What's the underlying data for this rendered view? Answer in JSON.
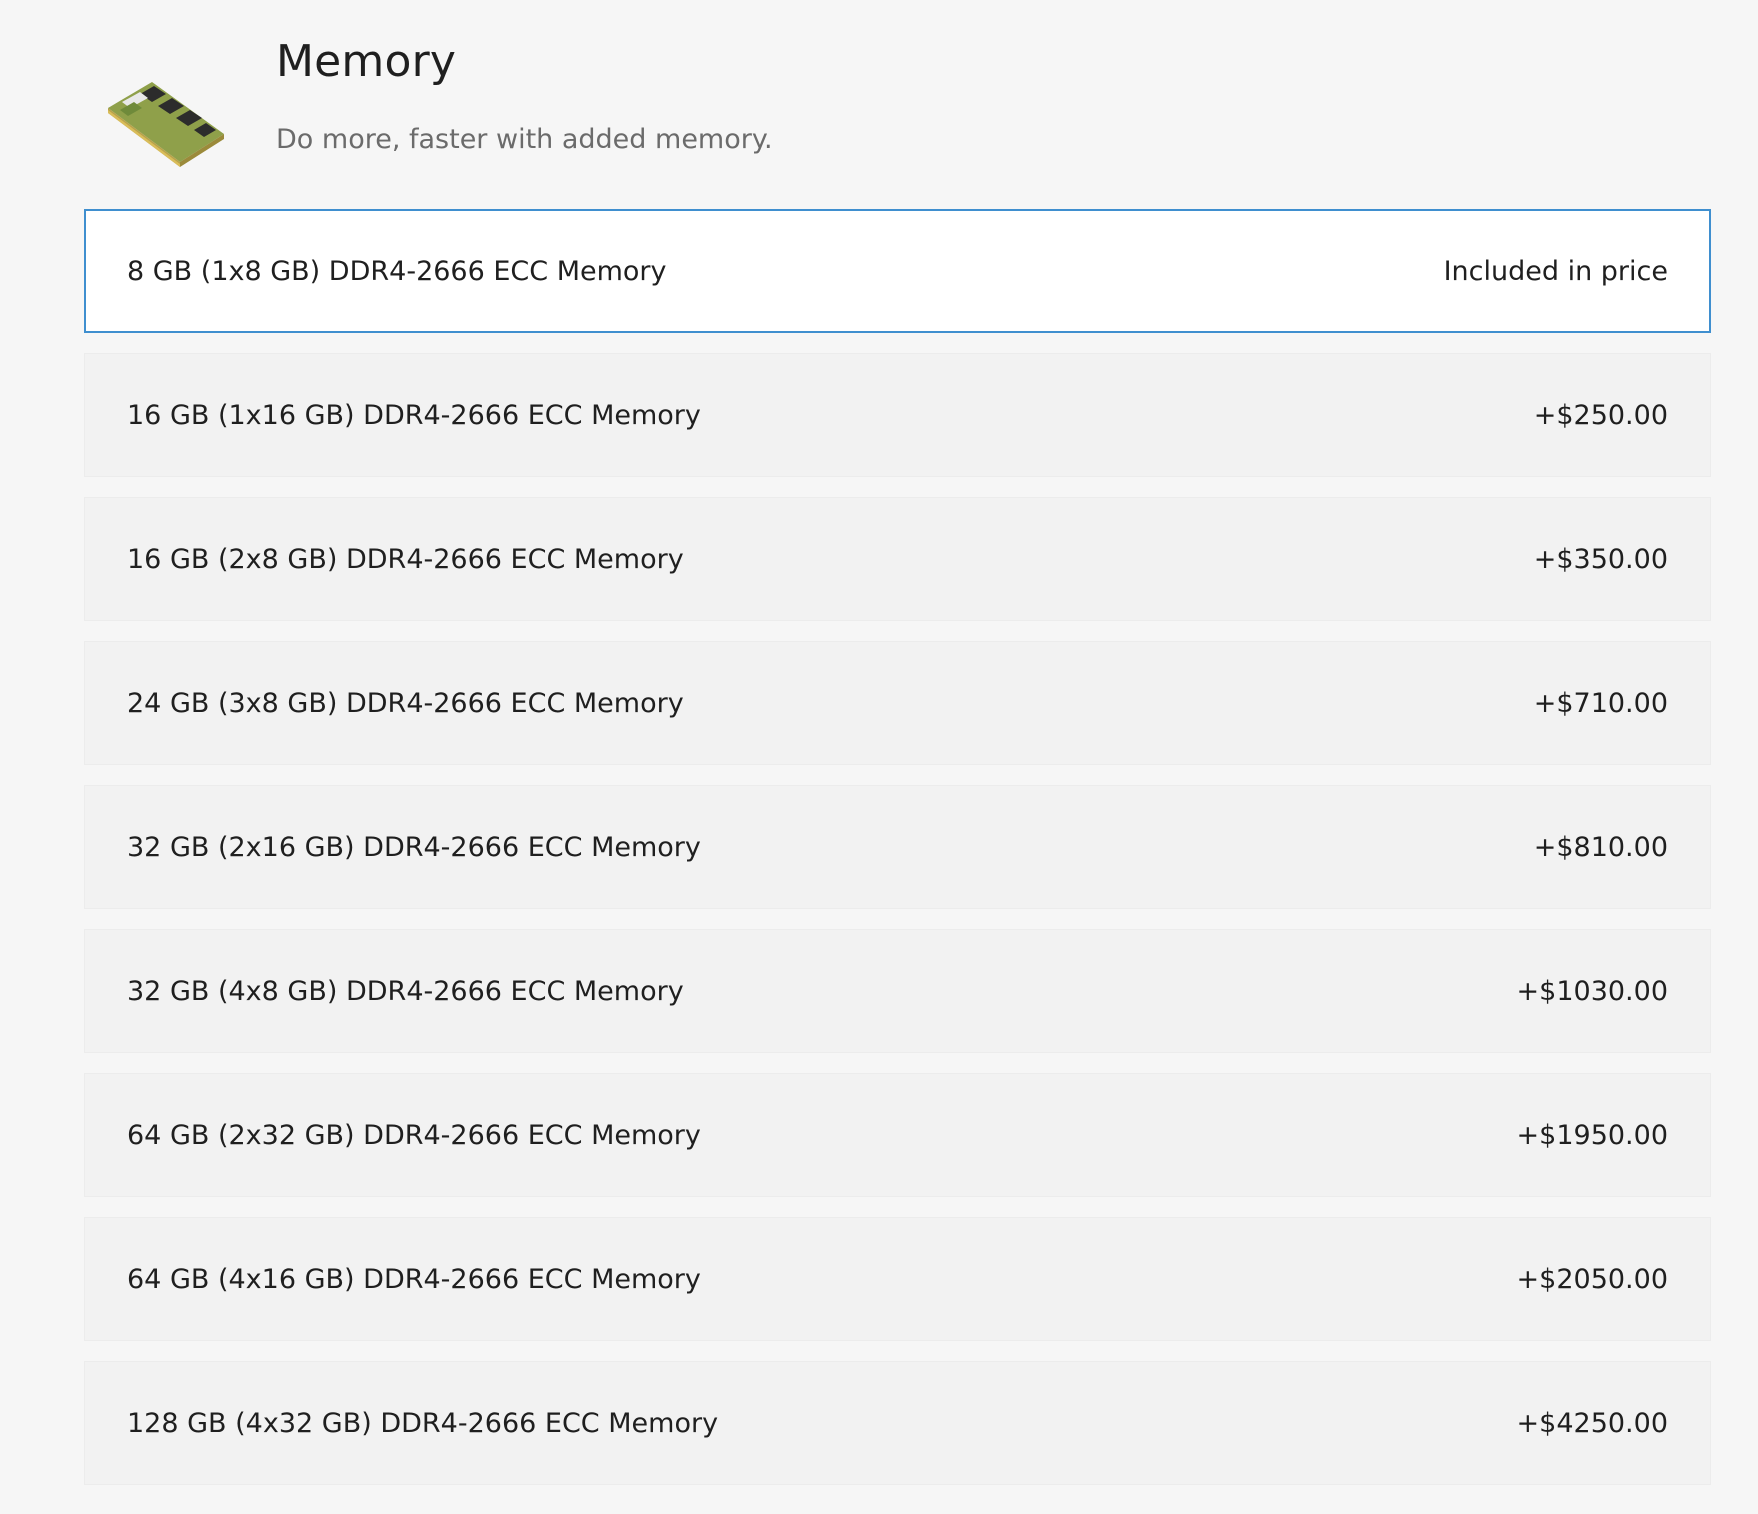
{
  "section": {
    "title": "Memory",
    "subtitle": "Do more, faster with added memory.",
    "image_icon": "memory-module-icon"
  },
  "options": [
    {
      "label": "8 GB (1x8 GB) DDR4-2666 ECC Memory",
      "price": "Included in price",
      "selected": true
    },
    {
      "label": "16 GB (1x16 GB) DDR4-2666 ECC Memory",
      "price": "+$250.00",
      "selected": false
    },
    {
      "label": "16 GB (2x8 GB) DDR4-2666 ECC Memory",
      "price": "+$350.00",
      "selected": false
    },
    {
      "label": "24 GB (3x8 GB) DDR4-2666 ECC Memory",
      "price": "+$710.00",
      "selected": false
    },
    {
      "label": "32 GB (2x16 GB) DDR4-2666 ECC Memory",
      "price": "+$810.00",
      "selected": false
    },
    {
      "label": "32 GB (4x8 GB) DDR4-2666 ECC Memory",
      "price": "+$1030.00",
      "selected": false
    },
    {
      "label": "64 GB (2x32 GB) DDR4-2666 ECC Memory",
      "price": "+$1950.00",
      "selected": false
    },
    {
      "label": "64 GB (4x16 GB) DDR4-2666 ECC Memory",
      "price": "+$2050.00",
      "selected": false
    },
    {
      "label": "128 GB (4x32 GB) DDR4-2666 ECC Memory",
      "price": "+$4250.00",
      "selected": false
    }
  ],
  "colors": {
    "selected_border": "#3f8fcf",
    "option_background": "#f2f2f2",
    "selected_background": "#ffffff",
    "page_background": "#f6f6f6"
  }
}
